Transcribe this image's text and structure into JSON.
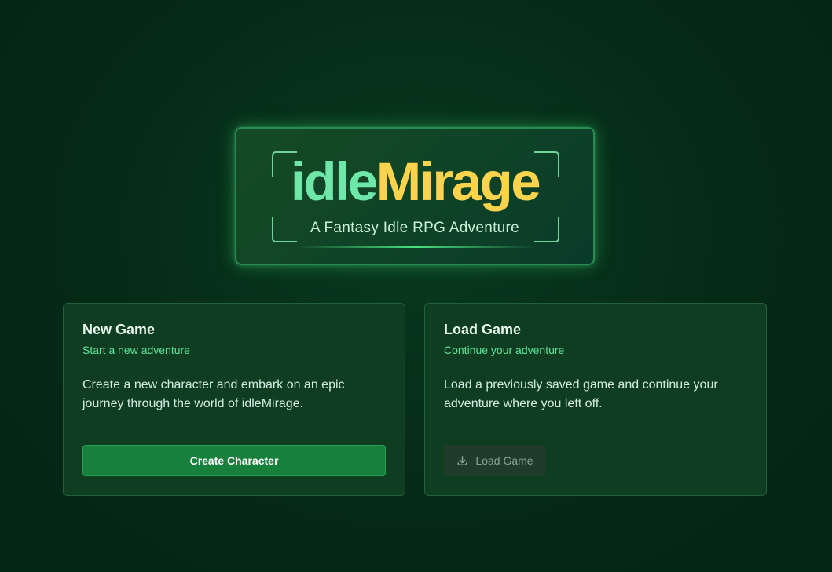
{
  "logo": {
    "title_part1": "idle",
    "title_part2": "Mirage",
    "subtitle": "A Fantasy Idle RPG Adventure"
  },
  "new_game": {
    "title": "New Game",
    "subtitle": "Start a new adventure",
    "description": "Create a new character and embark on an epic journey through the world of idleMirage.",
    "button_label": "Create Character"
  },
  "load_game": {
    "title": "Load Game",
    "subtitle": "Continue your adventure",
    "description": "Load a previously saved game and continue your adventure where you left off.",
    "button_label": "Load Game",
    "button_icon": "download-icon",
    "button_disabled": true
  },
  "colors": {
    "background": "#062a18",
    "accent_green": "#6ee7a8",
    "accent_gold": "#fcd34d",
    "primary_button": "#16803c"
  }
}
